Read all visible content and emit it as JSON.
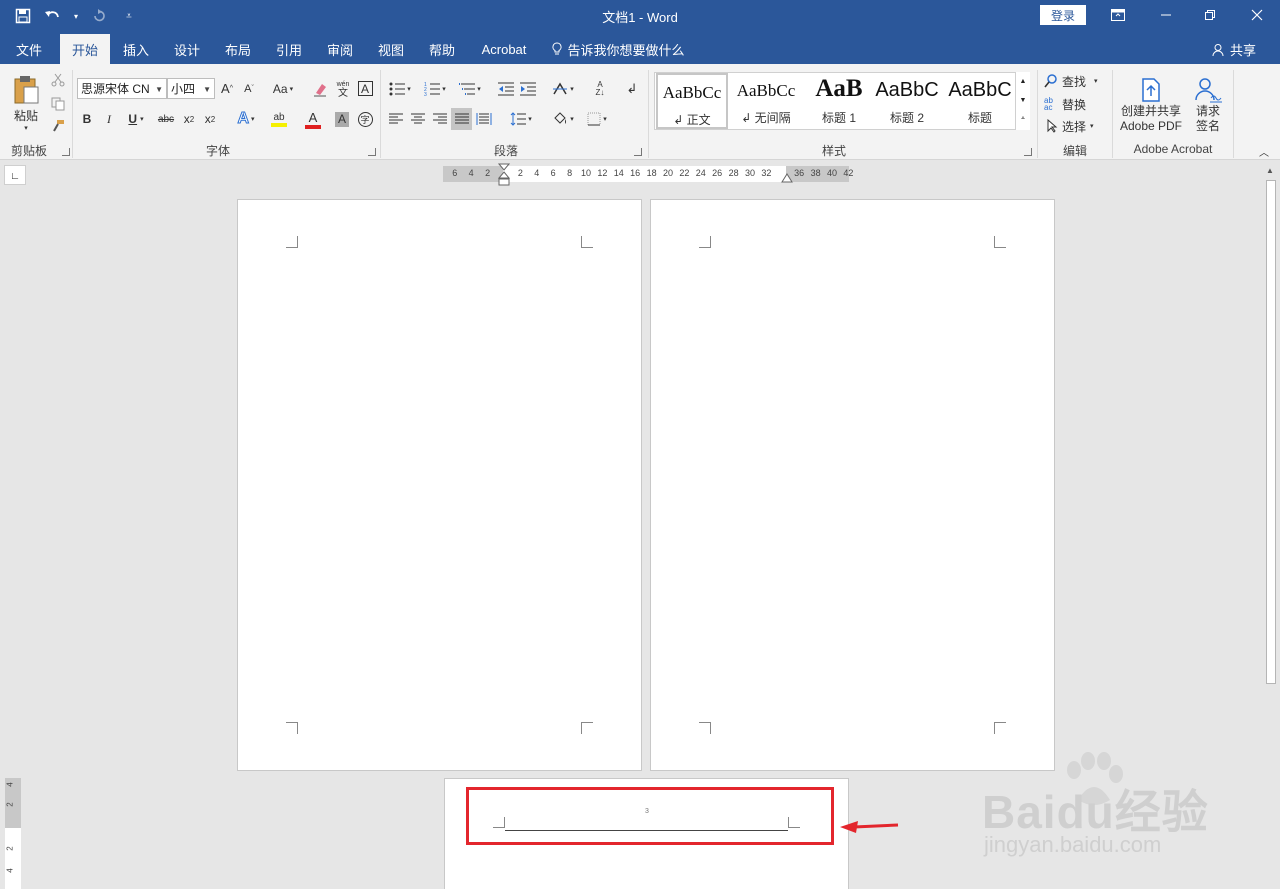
{
  "window": {
    "title": "文档1  -  Word",
    "login_label": "登录",
    "share_label": "共享"
  },
  "tabs": [
    {
      "label": "文件"
    },
    {
      "label": "开始"
    },
    {
      "label": "插入"
    },
    {
      "label": "设计"
    },
    {
      "label": "布局"
    },
    {
      "label": "引用"
    },
    {
      "label": "审阅"
    },
    {
      "label": "视图"
    },
    {
      "label": "帮助"
    },
    {
      "label": "Acrobat"
    }
  ],
  "active_tab": "开始",
  "tell_me": "告诉我你想要做什么",
  "ribbon": {
    "clipboard": {
      "paste_label": "粘贴",
      "group_label": "剪贴板"
    },
    "font": {
      "font_name": "思源宋体 CN",
      "font_size": "小四",
      "group_label": "字体"
    },
    "paragraph": {
      "group_label": "段落"
    },
    "styles": {
      "group_label": "样式",
      "items": [
        {
          "sample": "AaBbCc",
          "name": "↲ 正文"
        },
        {
          "sample": "AaBbCc",
          "name": "↲ 无间隔"
        },
        {
          "sample": "AaB",
          "name": "标题 1"
        },
        {
          "sample": "AaBbC",
          "name": "标题 2"
        },
        {
          "sample": "AaBbC",
          "name": "标题"
        }
      ]
    },
    "editing": {
      "find": "查找",
      "replace": "替换",
      "select": "选择",
      "group_label": "编辑"
    },
    "acrobat": {
      "create_pdf_line1": "创建并共享",
      "create_pdf_line2": "Adobe PDF",
      "sign_line1": "请求",
      "sign_line2": "签名",
      "group_label": "Adobe Acrobat"
    }
  },
  "ruler": {
    "left_ticks": [
      "6",
      "4",
      "2"
    ],
    "ticks": [
      "2",
      "4",
      "6",
      "8",
      "10",
      "12",
      "14",
      "16",
      "18",
      "20",
      "22",
      "24",
      "26",
      "28",
      "30",
      "32"
    ],
    "right_ticks": [
      "36",
      "38",
      "40",
      "42"
    ]
  },
  "vruler": {
    "ticks": [
      "4",
      "2",
      "2",
      "4"
    ]
  },
  "page3": {
    "page_number": "3"
  },
  "watermark": {
    "brand": "Baidu经验",
    "url": "jingyan.baidu.com"
  },
  "colors": {
    "brand_blue": "#2b579a",
    "highlight_red": "#e3262d"
  }
}
